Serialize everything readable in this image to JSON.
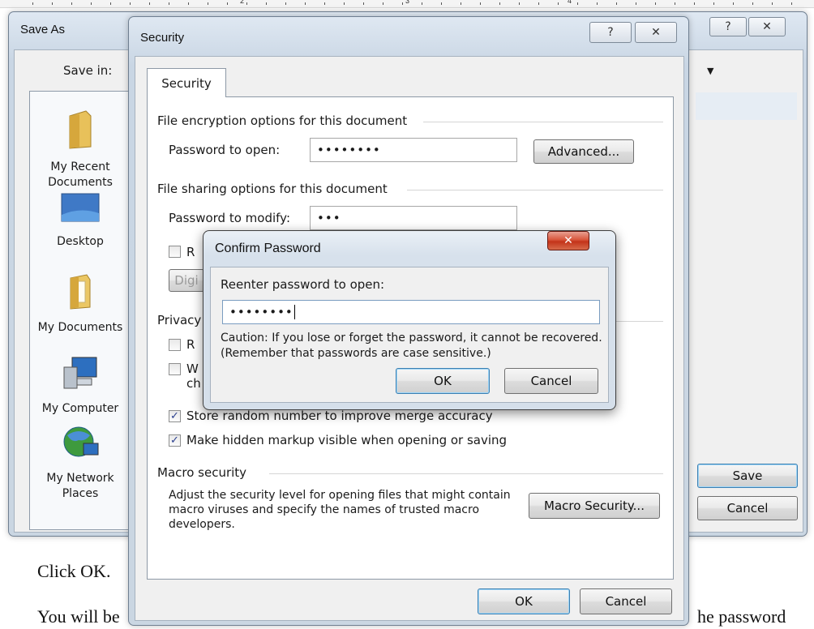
{
  "ruler": {
    "numbers": [
      "2",
      "3",
      "4"
    ]
  },
  "document": {
    "line1": "Click OK.",
    "line2_left": "You will be",
    "line2_right": "he password"
  },
  "save_as": {
    "title": "Save As",
    "save_in_label": "Save in:",
    "places": [
      {
        "label": "My Recent Documents",
        "icon": "recent-documents-folder-icon"
      },
      {
        "label": "Desktop",
        "icon": "desktop-icon"
      },
      {
        "label": "My Documents",
        "icon": "my-documents-folder-icon"
      },
      {
        "label": "My Computer",
        "icon": "computer-icon"
      },
      {
        "label": "My Network Places",
        "icon": "network-globe-icon"
      }
    ],
    "save_button": "Save",
    "cancel_button": "Cancel",
    "help_glyph": "?",
    "close_glyph": "✕"
  },
  "security": {
    "title": "Security",
    "tab": "Security",
    "help_glyph": "?",
    "close_glyph": "✕",
    "encryption_group": "File encryption options for this document",
    "password_open_label": "Password to open:",
    "password_open_value": "••••••••",
    "advanced_button": "Advanced...",
    "sharing_group": "File sharing options for this document",
    "password_modify_label": "Password to modify:",
    "password_modify_value": "•••",
    "readonly_partial": "R",
    "digital_partial": "Digi",
    "privacy_group": "Privacy",
    "privacy_partial_1": "R",
    "privacy_partial_2": "W",
    "privacy_partial_2b": "ch",
    "store_random_label": "Store random number to improve merge accuracy",
    "store_random_checked": true,
    "hidden_markup_label": "Make hidden markup visible when opening or saving",
    "hidden_markup_checked": true,
    "macro_group": "Macro security",
    "macro_text": "Adjust the security level for opening files that might contain macro viruses and specify the names of trusted macro developers.",
    "macro_button": "Macro Security...",
    "ok_button": "OK",
    "cancel_button": "Cancel"
  },
  "confirm": {
    "title": "Confirm Password",
    "close_glyph": "✕",
    "prompt": "Reenter password to open:",
    "value": "••••••••",
    "caution": "Caution:  If you lose or forget the password, it cannot be recovered. (Remember that passwords are case sensitive.)",
    "ok_button": "OK",
    "cancel_button": "Cancel"
  },
  "colors": {
    "title_bar": "#cad6e2",
    "client": "#f0f0f0",
    "default_button_border": "#3c7fb1",
    "close_button_red": "#c33319"
  }
}
